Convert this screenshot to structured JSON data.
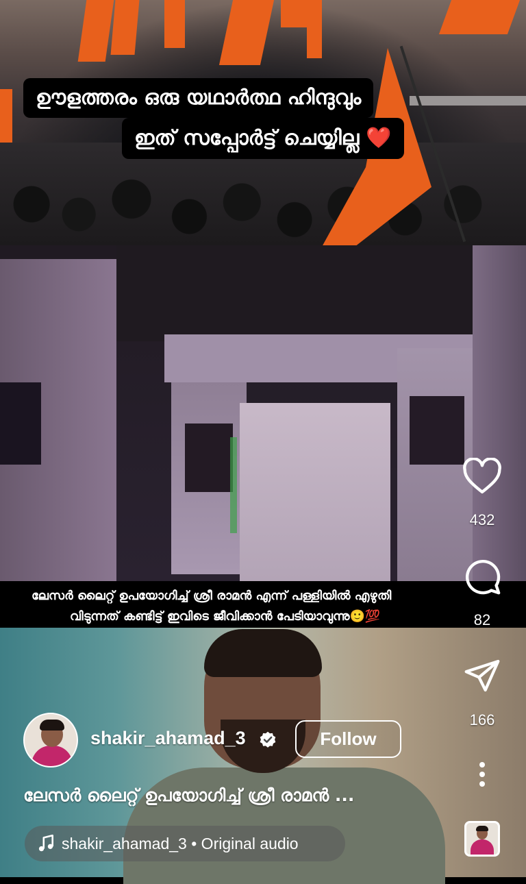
{
  "caption": {
    "line1": "ഊളത്തരം ഒരു യഥാർത്ഥ ഹിന്ദുവും",
    "line2": "ഇത് സപ്പോർട്ട് ചെയ്യില്ല",
    "line2_emoji": "❤️"
  },
  "subtitle_strip": {
    "line1": "ലേസർ ലൈറ്റ് ഉപയോഗിച്ച് ശ്രീ രാമൻ എന്ന് പള്ളിയിൽ എഴുതി",
    "line2": "വിടുന്നത് കണ്ടിട്ട് ഇവിടെ ജീവിക്കാൻ പേടിയാവുന്നു🙂💯"
  },
  "actions": {
    "like_count": "432",
    "comment_count": "82",
    "share_count": "166"
  },
  "author": {
    "username": "shakir_ahamad_3",
    "follow_label": "Follow"
  },
  "description": "ലേസർ ലൈറ്റ് ഉപയോഗിച്ച് ശ്രീ രാമൻ ...",
  "audio": {
    "label": "shakir_ahamad_3 • Original audio"
  },
  "icons": {
    "like": "heart-icon",
    "comment": "comment-icon",
    "share": "send-icon",
    "more": "more-vertical-icon",
    "audio": "music-note-icon",
    "verified": "verified-badge-icon"
  },
  "colors": {
    "flag_orange": "#e8601c",
    "heart_red": "#e3142b"
  }
}
